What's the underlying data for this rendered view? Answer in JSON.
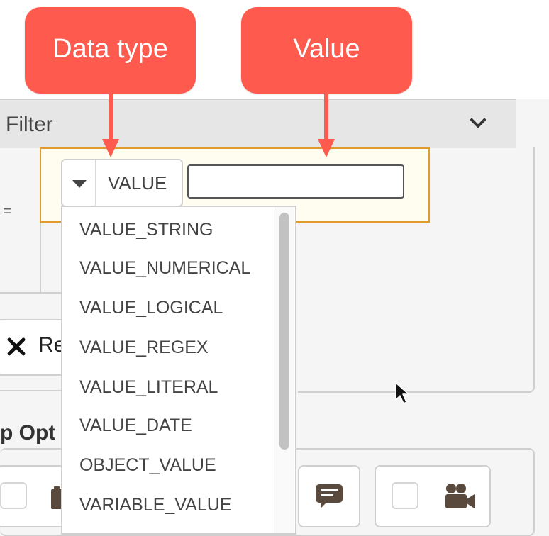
{
  "callouts": {
    "data_type": "Data type",
    "value": "Value"
  },
  "filter": {
    "title": "Filter",
    "chevron_icon": "chevron-down-icon"
  },
  "condition": {
    "operator": "="
  },
  "data_type_select": {
    "selected": "VALUE",
    "caret_icon": "caret-down-icon"
  },
  "value_input": {
    "value": "",
    "placeholder": ""
  },
  "dropdown": {
    "options": [
      "VALUE_STRING",
      "VALUE_NUMERICAL",
      "VALUE_LOGICAL",
      "VALUE_REGEX",
      "VALUE_LITERAL",
      "VALUE_DATE",
      "OBJECT_VALUE",
      "VARIABLE_VALUE"
    ]
  },
  "remove_button": {
    "label": "Re",
    "icon": "close-icon"
  },
  "options_section": {
    "title": "p Opt",
    "icons": [
      "clipboard-icon",
      "comment-icon",
      "video-camera-icon"
    ]
  },
  "colors": {
    "callout": "#ff5a4e",
    "highlight_border": "#e09a2e",
    "highlight_bg": "#fffdf0",
    "icon_dark": "#5a4a3e"
  }
}
